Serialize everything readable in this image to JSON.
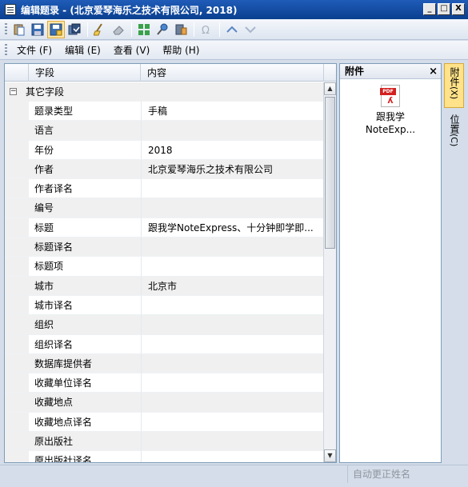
{
  "window": {
    "title": "编辑题录 - (北京爱琴海乐之技术有限公司, 2018)",
    "controls": [
      "_",
      "□",
      "X"
    ]
  },
  "toolbar": {
    "buttons": [
      "paste-icon",
      "save-icon",
      "save-as-icon",
      "copy-record-icon",
      "clear-icon",
      "eraser-icon",
      "grid-icon",
      "pin-icon",
      "link-icon",
      "omega-icon",
      "arrow-up-icon",
      "arrow-down-icon"
    ]
  },
  "menu": {
    "items": [
      "文件 (F)",
      "编辑 (E)",
      "查看 (V)",
      "帮助 (H)"
    ]
  },
  "grid": {
    "columns": [
      "字段",
      "内容"
    ],
    "group": "其它字段",
    "rows": [
      {
        "field": "题录类型",
        "value": "手稿"
      },
      {
        "field": "语言",
        "value": ""
      },
      {
        "field": "年份",
        "value": "2018"
      },
      {
        "field": "作者",
        "value": "北京爱琴海乐之技术有限公司"
      },
      {
        "field": "作者译名",
        "value": ""
      },
      {
        "field": "编号",
        "value": ""
      },
      {
        "field": "标题",
        "value": "跟我学NoteExpress、十分钟即学即..."
      },
      {
        "field": "标题译名",
        "value": ""
      },
      {
        "field": "标题项",
        "value": ""
      },
      {
        "field": "城市",
        "value": "北京市"
      },
      {
        "field": "城市译名",
        "value": ""
      },
      {
        "field": "组织",
        "value": ""
      },
      {
        "field": "组织译名",
        "value": ""
      },
      {
        "field": "数据库提供者",
        "value": ""
      },
      {
        "field": "收藏单位译名",
        "value": ""
      },
      {
        "field": "收藏地点",
        "value": ""
      },
      {
        "field": "收藏地点译名",
        "value": ""
      },
      {
        "field": "原出版社",
        "value": ""
      },
      {
        "field": "原出版社译名",
        "value": ""
      }
    ]
  },
  "attachments": {
    "header": "附件",
    "close": "×",
    "file": {
      "icon": "pdf-file-icon",
      "badge": "PDF",
      "name_line1": "跟我学",
      "name_line2": "NoteExp..."
    }
  },
  "side_tabs": [
    {
      "label": "附件",
      "key": "(X)"
    },
    {
      "label": "位置",
      "key": "(C)"
    }
  ],
  "status": {
    "text": "自动更正姓名"
  }
}
